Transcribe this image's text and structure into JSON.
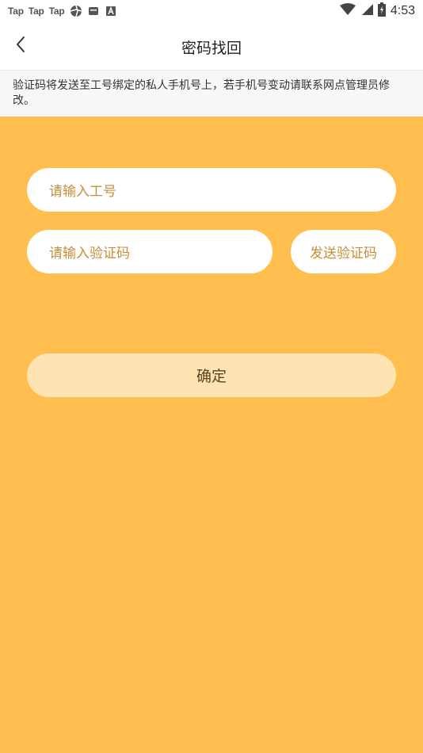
{
  "status_bar": {
    "apps": [
      "Tap",
      "Tap",
      "Tap"
    ],
    "icons": [
      "aperture-icon",
      "mail-icon",
      "font-icon"
    ],
    "time": "4:53",
    "right_icons": [
      "wifi-icon",
      "signal-icon",
      "battery-icon"
    ]
  },
  "header": {
    "back_icon": "chevron-left-icon",
    "title": "密码找回"
  },
  "notice": {
    "text": "验证码将发送至工号绑定的私人手机号上，若手机号变动请联系网点管理员修改。"
  },
  "form": {
    "employee_id_placeholder": "请输入工号",
    "code_placeholder": "请输入验证码",
    "send_code_label": "发送验证码",
    "confirm_label": "确定"
  },
  "colors": {
    "background": "#ffbe4d",
    "input_background": "#ffffff",
    "placeholder_text": "#c58e3a",
    "confirm_background": "#ffe4b3",
    "confirm_text": "#5a4420"
  }
}
